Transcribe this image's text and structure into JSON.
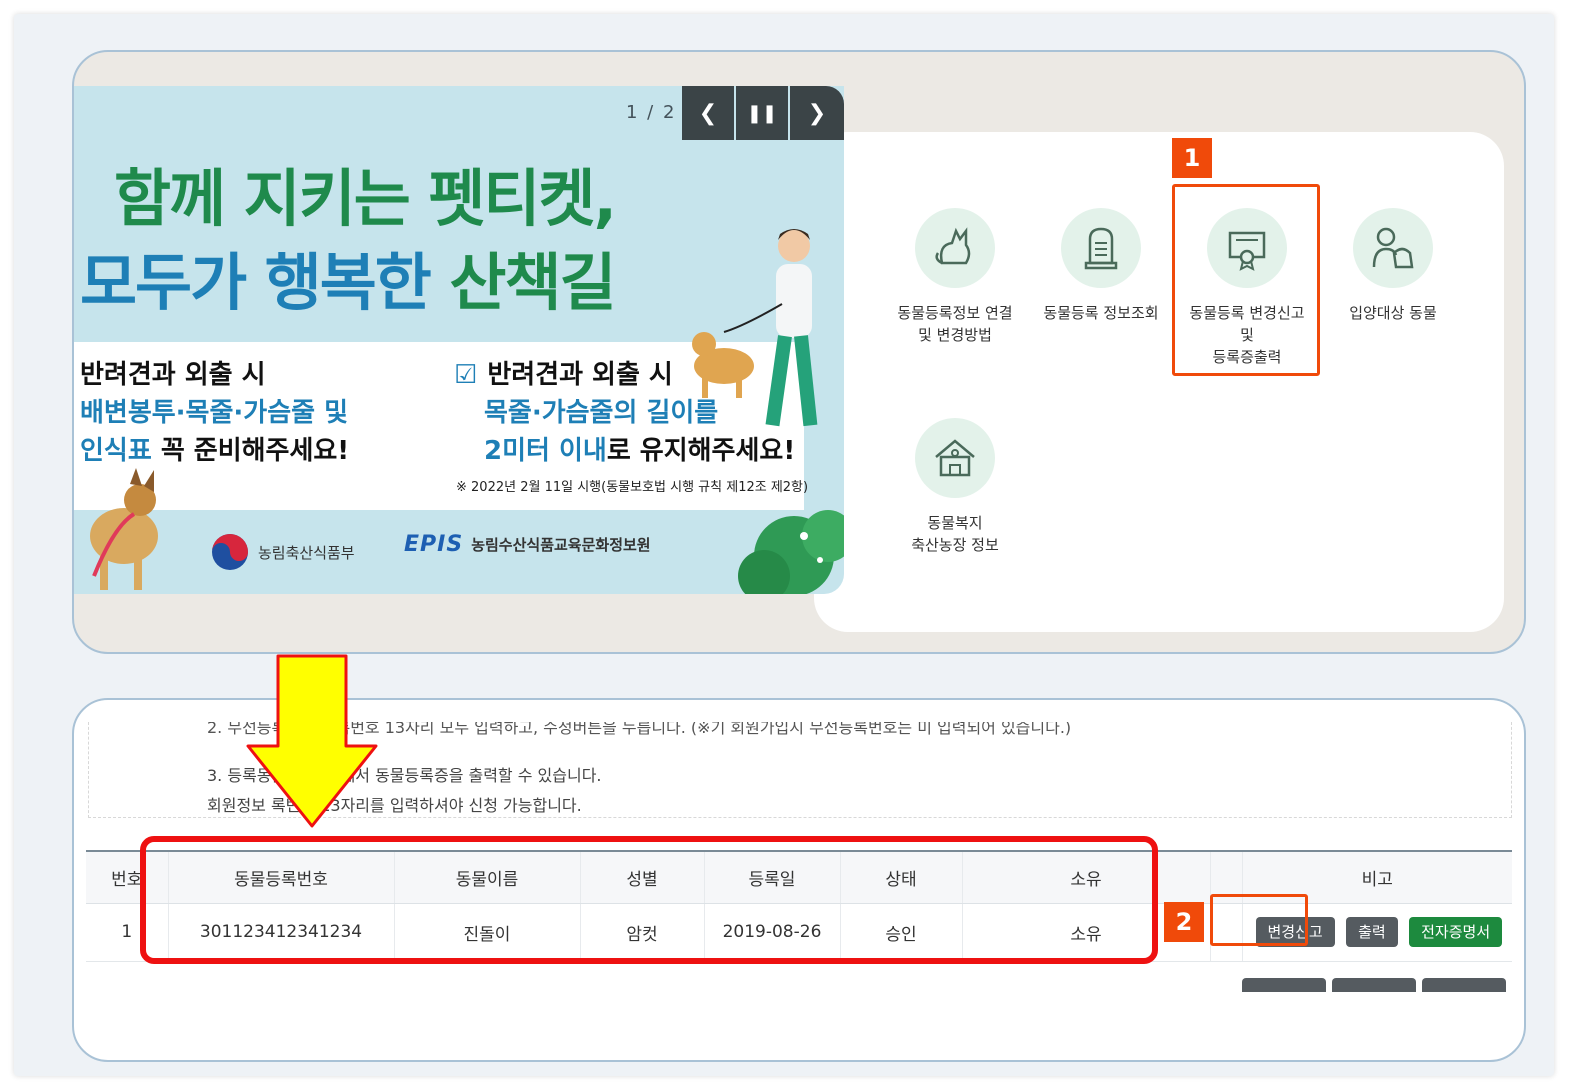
{
  "banner": {
    "counter": "1 / 2",
    "prev_icon": "chevron-left-icon",
    "pause_icon": "pause-icon",
    "next_icon": "chevron-right-icon",
    "headline1": "함께 지키는 펫티켓,",
    "headline2_a": "모두가 ",
    "headline2_b": "행복한",
    "headline2_c": " 산책길",
    "left_l1": "반려견과 외출 시",
    "left_l2": "배변봉투·목줄·가슴줄 및",
    "left_l3a": "인식표",
    "left_l3b": " 꼭 준비해주세요!",
    "right_l1": "반려견과 외출 시",
    "right_l2": "목줄·가슴줄의 길이를",
    "right_l3a": "2미터 이내",
    "right_l3b": "로 유지해주세요!",
    "small": "※ 2022년 2월 11일 시행(동물보호법 시행 규칙 제12조 제2항)",
    "org1": "농림축산식품부",
    "org2_logo": "EPIS",
    "org2": "농림수산식품교육문화정보원"
  },
  "menu": [
    {
      "icon": "cat-icon",
      "line1": "동물등록정보 연결",
      "line2": "및 변경방법",
      "line3": ""
    },
    {
      "icon": "gravestone-icon",
      "line1": "동물등록 정보조회",
      "line2": "",
      "line3": ""
    },
    {
      "icon": "certificate-icon",
      "line1": "동물등록 변경신고",
      "line2": "및",
      "line3": "등록증출력"
    },
    {
      "icon": "adoption-icon",
      "line1": "입양대상 동물",
      "line2": "",
      "line3": ""
    },
    {
      "icon": "farm-icon",
      "line1": "동물복지",
      "line2": "축산농장 정보",
      "line3": ""
    }
  ],
  "badges": {
    "one": "1",
    "two": "2"
  },
  "info": {
    "line2": "2. 무선등록    무선등록번호 13자리 모두 입력하고, 수정버튼을 누릅니다. (※기 회원가입시 무선등록번호는 미 입력되어 있습니다.)",
    "line3": "3. 등록동물            변 메뉴에서 동물등록증을 출력할 수 있습니다.",
    "line4": "회원정보            록번호 13자리를 입력하셔야 신청 가능합니다."
  },
  "table": {
    "headers": [
      "번호",
      "동물등록번호",
      "동물이름",
      "성별",
      "등록일",
      "상태",
      "소유",
      "",
      "비고"
    ],
    "row": [
      "1",
      "301123412341234",
      "진돌이",
      "암컷",
      "2019-08-26",
      "승인",
      "소유"
    ],
    "buttons": {
      "change": "변경신고",
      "print": "출력",
      "cert": "전자증명서"
    }
  },
  "colors": {
    "accent_red": "#ee1111",
    "badge_orange": "#f04a0a",
    "arrow_yellow": "#ffff00",
    "green": "#1d8a3e"
  }
}
